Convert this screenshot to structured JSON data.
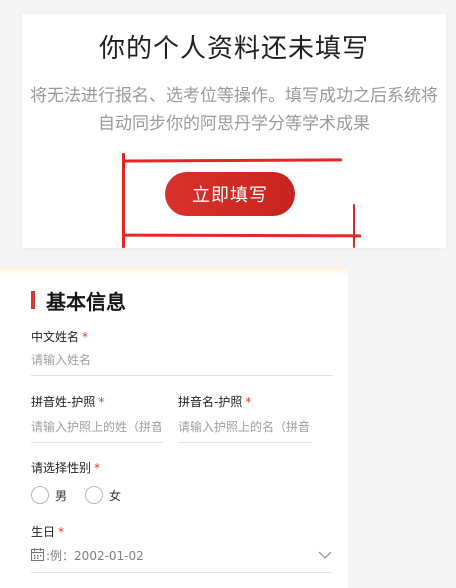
{
  "prompt_card": {
    "title": "你的个人资料还未填写",
    "description": "将无法进行报名、选考位等操作。填写成功之后系统将自动同步你的阿思丹学分等学术成果",
    "button_label": "立即填写",
    "accent_color": "#d9322c",
    "annotation_color": "#e52626"
  },
  "form": {
    "section_title": "基本信息",
    "required_mark": "*",
    "chinese_name": {
      "label": "中文姓名",
      "placeholder": "请输入姓名"
    },
    "pinyin_surname": {
      "label": "拼音姓-护照",
      "placeholder": "请输入护照上的姓（拼音）"
    },
    "pinyin_given": {
      "label": "拼音名-护照",
      "placeholder": "请输入护照上的名（拼音）"
    },
    "gender": {
      "label": "请选择性别",
      "options": [
        "男",
        "女"
      ]
    },
    "birthday": {
      "label": "生日",
      "placeholder": "例：2002-01-02",
      "icon": "calendar-icon"
    }
  }
}
